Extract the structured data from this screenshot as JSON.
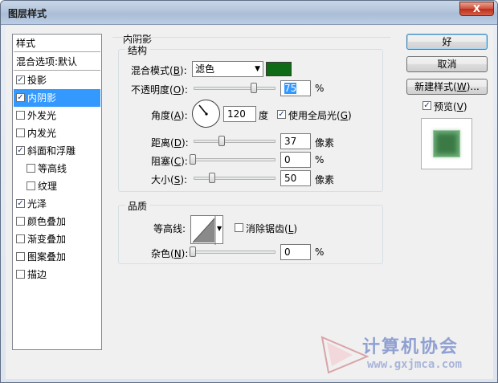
{
  "window": {
    "title": "图层样式",
    "close_glyph": "X"
  },
  "styles_list": {
    "header": "样式",
    "blend_options": "混合选项:默认",
    "items": [
      {
        "label": "投影",
        "checked": true,
        "indent": false,
        "selected": false
      },
      {
        "label": "内阴影",
        "checked": true,
        "indent": false,
        "selected": true
      },
      {
        "label": "外发光",
        "checked": false,
        "indent": false,
        "selected": false
      },
      {
        "label": "内发光",
        "checked": false,
        "indent": false,
        "selected": false
      },
      {
        "label": "斜面和浮雕",
        "checked": true,
        "indent": false,
        "selected": false
      },
      {
        "label": "等高线",
        "checked": false,
        "indent": true,
        "selected": false
      },
      {
        "label": "纹理",
        "checked": false,
        "indent": true,
        "selected": false
      },
      {
        "label": "光泽",
        "checked": true,
        "indent": false,
        "selected": false
      },
      {
        "label": "颜色叠加",
        "checked": false,
        "indent": false,
        "selected": false
      },
      {
        "label": "渐变叠加",
        "checked": false,
        "indent": false,
        "selected": false
      },
      {
        "label": "图案叠加",
        "checked": false,
        "indent": false,
        "selected": false
      },
      {
        "label": "描边",
        "checked": false,
        "indent": false,
        "selected": false
      }
    ]
  },
  "inner_shadow": {
    "title": "内阴影",
    "structure": {
      "title": "结构",
      "blend_mode_label": "混合模式(",
      "blend_mode_key": "B",
      "blend_mode_value": "滤色",
      "shadow_color": "#0f6b16",
      "opacity_label": "不透明度(",
      "opacity_key": "O",
      "opacity_value": "75",
      "opacity_unit": "%",
      "angle_label": "角度(",
      "angle_key": "A",
      "angle_value": "120",
      "angle_unit": "度",
      "global_light_label": "使用全局光(",
      "global_light_key": "G",
      "global_light_checked": true,
      "distance_label": "距离(",
      "distance_key": "D",
      "distance_value": "37",
      "distance_unit": "像素",
      "choke_label": "阻塞(",
      "choke_key": "C",
      "choke_value": "0",
      "choke_unit": "%",
      "size_label": "大小(",
      "size_key": "S",
      "size_value": "50",
      "size_unit": "像素"
    },
    "quality": {
      "title": "品质",
      "contour_label": "等高线:",
      "anti_alias_label": "消除锯齿(",
      "anti_alias_key": "L",
      "anti_alias_checked": false,
      "noise_label": "杂色(",
      "noise_key": "N",
      "noise_value": "0",
      "noise_unit": "%"
    }
  },
  "buttons": {
    "ok": "好",
    "cancel": "取消",
    "new_style": "新建样式(",
    "new_style_key": "W",
    "new_style_suffix": ")...",
    "preview_label": "预览(",
    "preview_key": "V",
    "preview_checked": true
  },
  "watermark": {
    "name": "计算机协会",
    "url": "www.gxjmca.com",
    "color": "#6f86c9"
  },
  "label_close": ")",
  "label_close_colon": "):"
}
